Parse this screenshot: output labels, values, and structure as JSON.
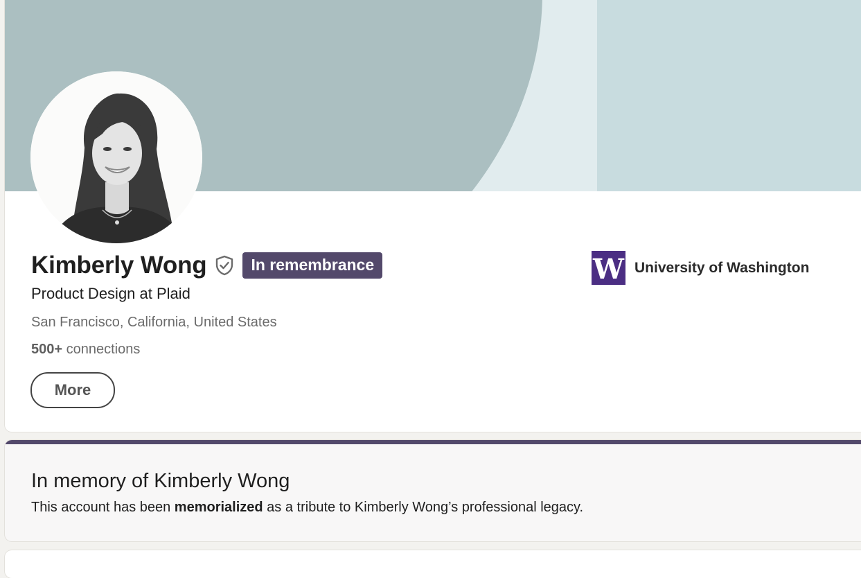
{
  "profile": {
    "name": "Kimberly Wong",
    "badge": "In remembrance",
    "headline": "Product Design at Plaid",
    "location": "San Francisco, California, United States",
    "connections_count": "500+",
    "connections_label": " connections",
    "more_button": "More",
    "verified_icon": "shield-check-icon",
    "avatar_alt": "Kimberly Wong"
  },
  "education": {
    "school_name": "University of Washington",
    "logo_letter": "W"
  },
  "memorial": {
    "title": "In memory of Kimberly Wong",
    "body_prefix": "This account has been ",
    "body_bold": "memorialized",
    "body_suffix": " as a tribute to Kimberly Wong’s professional legacy."
  },
  "colors": {
    "badge": "#53496b",
    "banner_left": "#abbfc1",
    "banner_right": "#c8dcdf",
    "uw_purple": "#4b2e83"
  }
}
